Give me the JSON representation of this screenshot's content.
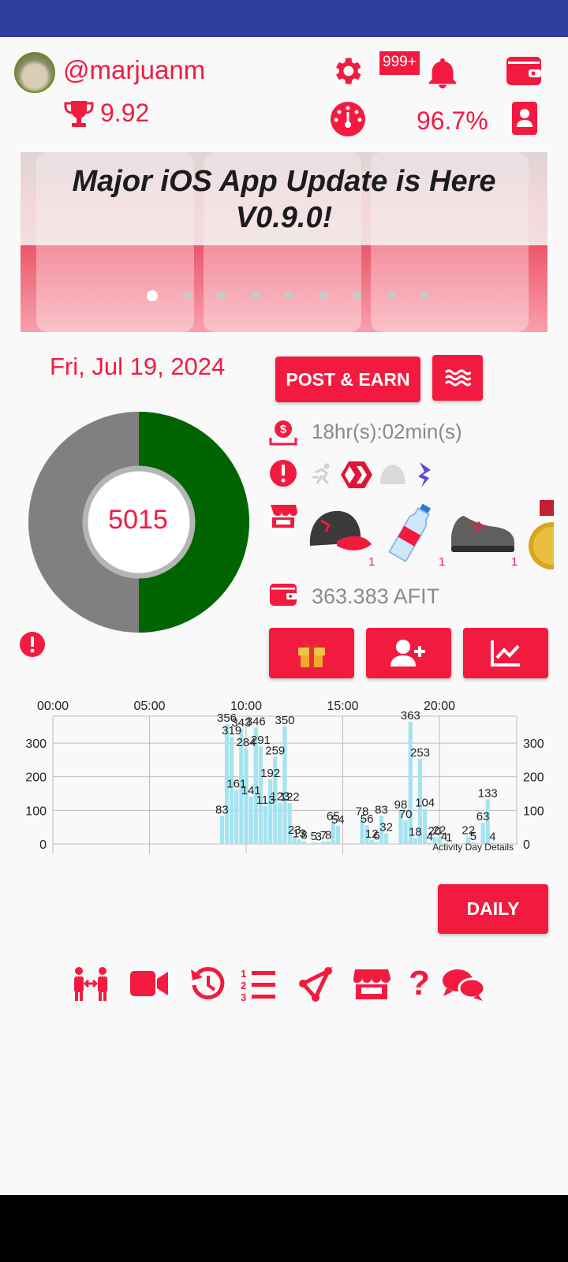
{
  "header": {
    "username": "@marjuanm",
    "trophy_score": "9.92",
    "notifications_badge": "999+",
    "percentage": "96.7%"
  },
  "banner": {
    "title_line1": "Major iOS App Update is Here",
    "title_line2": "V0.9.0!",
    "slides_count": 9,
    "active_slide": 1
  },
  "activity": {
    "date": "Fri, Jul 19, 2024",
    "post_earn_label": "POST & EARN",
    "timer": "18hr(s):02min(s)",
    "steps": "5015",
    "steps_progress": 0.5,
    "afit_balance": "363.383 AFIT",
    "gear_counts": [
      "1",
      "1",
      "1"
    ]
  },
  "chart_data": {
    "type": "bar",
    "x_tick_labels": [
      "00:00",
      "05:00",
      "10:00",
      "15:00",
      "20:00"
    ],
    "y_ticks": [
      0,
      100,
      200,
      300
    ],
    "ylim": [
      0,
      380
    ],
    "xlim": [
      0,
      24
    ],
    "caption": "Activity Day Details",
    "color": "#a4e4f0",
    "points": [
      {
        "t": 8.75,
        "v": 83
      },
      {
        "t": 9.0,
        "v": 356
      },
      {
        "t": 9.25,
        "v": 319
      },
      {
        "t": 9.5,
        "v": 161
      },
      {
        "t": 9.75,
        "v": 343
      },
      {
        "t": 10.0,
        "v": 284
      },
      {
        "t": 10.25,
        "v": 141
      },
      {
        "t": 10.5,
        "v": 346
      },
      {
        "t": 10.75,
        "v": 291
      },
      {
        "t": 11.0,
        "v": 113
      },
      {
        "t": 11.25,
        "v": 192
      },
      {
        "t": 11.5,
        "v": 259
      },
      {
        "t": 11.75,
        "v": 123
      },
      {
        "t": 12.0,
        "v": 350
      },
      {
        "t": 12.25,
        "v": 122
      },
      {
        "t": 12.5,
        "v": 23
      },
      {
        "t": 12.75,
        "v": 13
      },
      {
        "t": 13.0,
        "v": 8
      },
      {
        "t": 13.5,
        "v": 5
      },
      {
        "t": 13.75,
        "v": 3
      },
      {
        "t": 14.0,
        "v": 7
      },
      {
        "t": 14.25,
        "v": 8
      },
      {
        "t": 14.5,
        "v": 65
      },
      {
        "t": 14.75,
        "v": 54
      },
      {
        "t": 16.0,
        "v": 78
      },
      {
        "t": 16.25,
        "v": 56
      },
      {
        "t": 16.5,
        "v": 12
      },
      {
        "t": 16.75,
        "v": 6
      },
      {
        "t": 17.0,
        "v": 83
      },
      {
        "t": 17.25,
        "v": 32
      },
      {
        "t": 18.0,
        "v": 98
      },
      {
        "t": 18.25,
        "v": 70
      },
      {
        "t": 18.5,
        "v": 363
      },
      {
        "t": 18.75,
        "v": 18
      },
      {
        "t": 19.0,
        "v": 253
      },
      {
        "t": 19.25,
        "v": 104
      },
      {
        "t": 19.5,
        "v": 4
      },
      {
        "t": 19.75,
        "v": 20
      },
      {
        "t": 20.0,
        "v": 22
      },
      {
        "t": 20.25,
        "v": 4
      },
      {
        "t": 20.5,
        "v": 1
      },
      {
        "t": 21.5,
        "v": 22
      },
      {
        "t": 21.75,
        "v": 5
      },
      {
        "t": 22.25,
        "v": 63
      },
      {
        "t": 22.5,
        "v": 133
      },
      {
        "t": 22.75,
        "v": 4
      }
    ]
  },
  "daily_button": "DAILY",
  "icons": {
    "settings": "gear-icon",
    "notifications": "bell-icon",
    "wallet": "wallet-icon",
    "trophy": "trophy-icon",
    "speedometer": "gauge-icon",
    "profile": "id-badge-icon",
    "menu": "waves-icon",
    "timer": "money-download-icon",
    "alert": "alert-icon",
    "store": "store-icon",
    "gift": "gift-icon",
    "add_user": "user-plus-icon",
    "stats": "chart-line-icon",
    "bottom": [
      "friends-icon",
      "video-icon",
      "history-icon",
      "leaderboard-icon",
      "share-icon",
      "store-icon",
      "help-icon",
      "chat-icon"
    ]
  },
  "colors": {
    "accent": "#f21b3f",
    "donut_progress": "#006400",
    "donut_remaining": "#808080",
    "status_bar": "#2f3e9e"
  }
}
